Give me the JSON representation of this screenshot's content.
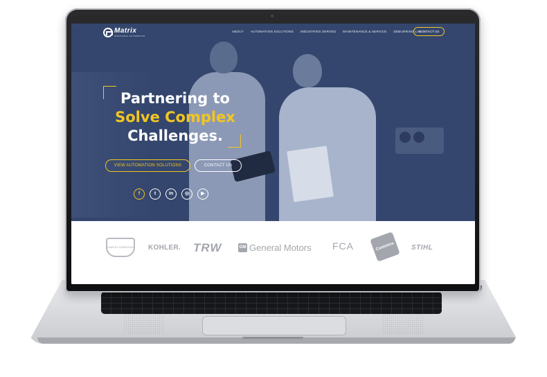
{
  "site": {
    "logo": {
      "name": "Matrix",
      "tagline": "INDUSTRIAL AUTOMATION"
    },
    "nav": {
      "links": [
        "ABOUT",
        "AUTOMATION SOLUTIONS",
        "INDUSTRIES SERVED",
        "MAINTENANCE & SERVICE",
        "DEBURRING LAB"
      ],
      "cta": "CONTACT US"
    },
    "hero": {
      "headline_line1": "Partnering to",
      "headline_line2": "Solve Complex",
      "headline_line3": "Challenges.",
      "primary_button": "VIEW AUTOMATION SOLUTIONS",
      "secondary_button": "CONTACT US",
      "socials": [
        {
          "icon": "facebook-icon",
          "glyph": "f"
        },
        {
          "icon": "twitter-icon",
          "glyph": "t"
        },
        {
          "icon": "linkedin-icon",
          "glyph": "in"
        },
        {
          "icon": "instagram-icon",
          "glyph": "◎"
        },
        {
          "icon": "youtube-icon",
          "glyph": "▶"
        }
      ]
    },
    "clients": {
      "harley": "HARLEY-DAVIDSON",
      "kohler": "KOHLER.",
      "trw": "TRW",
      "gm_mark": "GM",
      "gm": "General Motors",
      "fca": "FCA",
      "cummins": "Cummins",
      "stihl": "STIHL"
    }
  },
  "colors": {
    "hero_bg": "#34466d",
    "accent": "#f3c622",
    "logo_gray": "#a3a7ad"
  }
}
